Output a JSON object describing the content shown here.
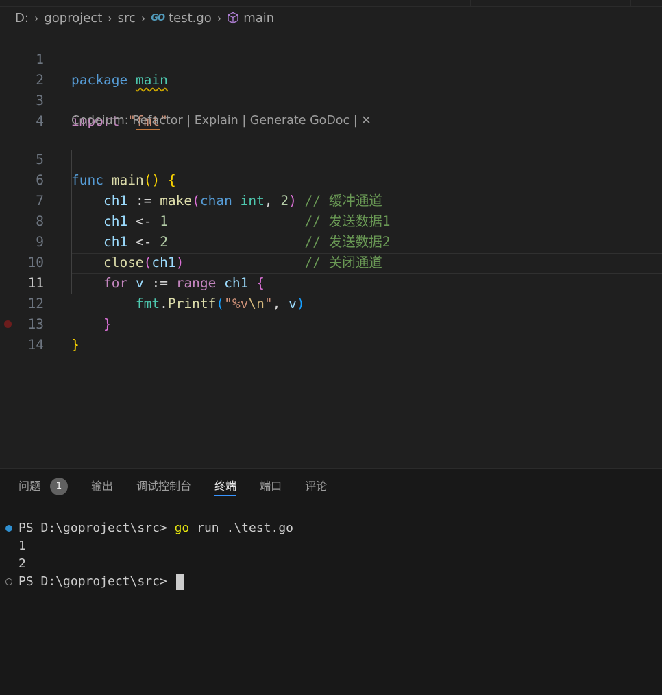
{
  "breadcrumb": {
    "drive": "D:",
    "folder1": "goproject",
    "folder2": "src",
    "file_icon_text": "GO",
    "file": "test.go",
    "symbol": "main"
  },
  "editor": {
    "line_numbers": [
      "1",
      "2",
      "3",
      "4",
      "5",
      "6",
      "7",
      "8",
      "9",
      "10",
      "11",
      "12",
      "13",
      "14"
    ],
    "codelens": "Codeium: Refactor | Explain | Generate GoDoc | ✕",
    "tokens": {
      "package": "package",
      "main_pkg": "main",
      "import": "import",
      "q1": "\"",
      "fmt_pkg": "fmt",
      "q2": "\"",
      "func": "func",
      "main_fn": "main",
      "lp": "(",
      "rp": ")",
      "lb": "{",
      "ch1": "ch1",
      "assign": ":=",
      "make": "make",
      "chan": "chan",
      "int": "int",
      "comma": ",",
      "two": "2",
      "cm_buffer": "// 缓冲通道",
      "send": "<-",
      "one": "1",
      "cm_send1": "// 发送数据1",
      "cm_send2": "// 发送数据2",
      "cm_close": "// 关闭通道",
      "close": "close",
      "for": "for",
      "v": "v",
      "range": "range",
      "fmt": "fmt",
      "dot": ".",
      "printf": "Printf",
      "fmtstr_a": "\"%v",
      "fmtstr_esc": "\\n",
      "fmtstr_b": "\"",
      "rb": "}"
    }
  },
  "panel": {
    "tabs": [
      {
        "label": "问题",
        "badge": "1"
      },
      {
        "label": "输出"
      },
      {
        "label": "调试控制台"
      },
      {
        "label": "终端"
      },
      {
        "label": "端口"
      },
      {
        "label": "评论"
      }
    ]
  },
  "terminal": {
    "prompt": "PS D:\\goproject\\src>",
    "cmd": "go",
    "args": "run .\\test.go",
    "out1": "1",
    "out2": "2"
  }
}
